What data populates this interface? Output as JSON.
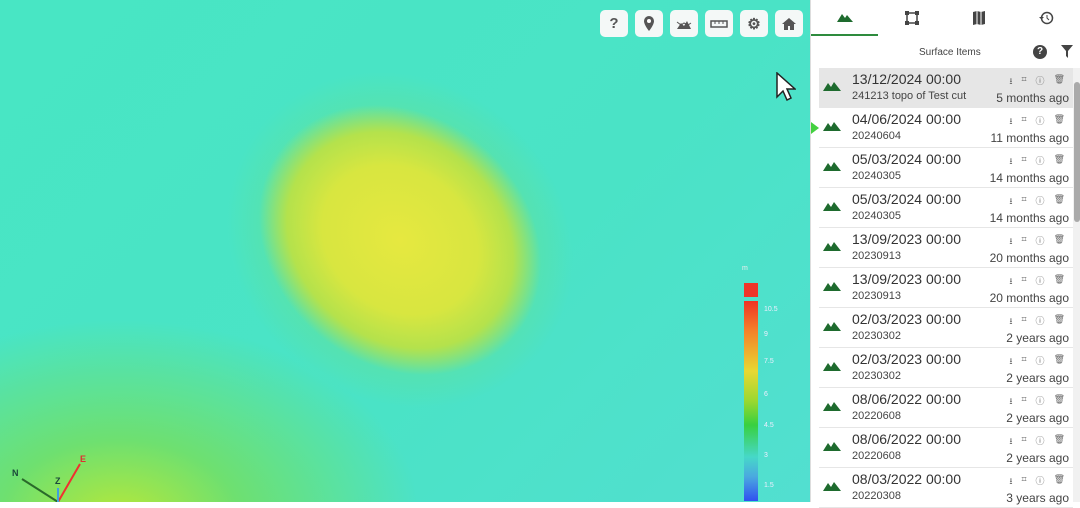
{
  "toolbar": {
    "help": "?",
    "items": [
      "help",
      "location",
      "terrain",
      "measure",
      "settings",
      "home"
    ]
  },
  "legend": {
    "unit": "m",
    "labels": [
      "10.5",
      "9",
      "7.5",
      "6",
      "4.5",
      "3",
      "1.5"
    ]
  },
  "axes": {
    "n": "N",
    "z": "Z",
    "e": "E"
  },
  "panel": {
    "tabs": [
      "surfaces",
      "boundary",
      "map",
      "history"
    ],
    "title": "Surface Items",
    "help": "?"
  },
  "items": [
    {
      "date": "13/12/2024 00:00",
      "name": "241213 topo of Test cut",
      "age": "5 months ago"
    },
    {
      "date": "04/06/2024 00:00",
      "name": "20240604",
      "age": "11 months ago"
    },
    {
      "date": "05/03/2024 00:00",
      "name": "20240305",
      "age": "14 months ago"
    },
    {
      "date": "05/03/2024 00:00",
      "name": "20240305",
      "age": "14 months ago"
    },
    {
      "date": "13/09/2023 00:00",
      "name": "20230913",
      "age": "20 months ago"
    },
    {
      "date": "13/09/2023 00:00",
      "name": "20230913",
      "age": "20 months ago"
    },
    {
      "date": "02/03/2023 00:00",
      "name": "20230302",
      "age": "2 years ago"
    },
    {
      "date": "02/03/2023 00:00",
      "name": "20230302",
      "age": "2 years ago"
    },
    {
      "date": "08/06/2022 00:00",
      "name": "20220608",
      "age": "2 years ago"
    },
    {
      "date": "08/06/2022 00:00",
      "name": "20220608",
      "age": "2 years ago"
    },
    {
      "date": "08/03/2022 00:00",
      "name": "20220308",
      "age": "3 years ago"
    }
  ]
}
